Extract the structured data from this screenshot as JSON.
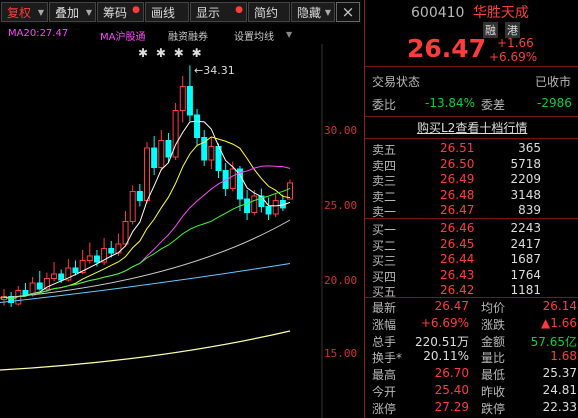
{
  "toolbar": {
    "buttons": [
      {
        "label": "复权",
        "active": true
      },
      {
        "label": "叠加",
        "active": false
      },
      {
        "label": "筹码",
        "active": false
      },
      {
        "label": "画线",
        "active": false
      },
      {
        "label": "显示",
        "active": false
      },
      {
        "label": "简约",
        "active": false
      },
      {
        "label": "隐藏",
        "active": false
      }
    ],
    "close_glyph": "×"
  },
  "legend": {
    "ma20": "MA20:27.47",
    "ma_extra": "MA沪股通",
    "margin": "融资融券",
    "setting": "设置均线"
  },
  "chart": {
    "stars": "✱ ✱ ✱      ✱",
    "high_marker": "34.31",
    "price_ticks": [
      "30.00",
      "25.00",
      "20.00",
      "15.00"
    ]
  },
  "quote": {
    "code": "600410",
    "name": "华胜天成",
    "badge_rong": "融",
    "badge_gang": "港",
    "price": "26.47",
    "change": "+1.66",
    "change_pct": "+6.69%"
  },
  "status": {
    "label": "交易状态",
    "value": "已收市",
    "weibi_label": "委比",
    "weibi_value": "-13.84%",
    "weicha_label": "委差",
    "weicha_value": "-2986"
  },
  "l2_link": "购买L2查看十档行情",
  "sell_orders": [
    {
      "label": "卖五",
      "price": "26.51",
      "vol": "365"
    },
    {
      "label": "卖四",
      "price": "26.50",
      "vol": "5718"
    },
    {
      "label": "卖三",
      "price": "26.49",
      "vol": "2209"
    },
    {
      "label": "卖二",
      "price": "26.48",
      "vol": "3148"
    },
    {
      "label": "卖一",
      "price": "26.47",
      "vol": "839"
    }
  ],
  "buy_orders": [
    {
      "label": "买一",
      "price": "26.46",
      "vol": "2243"
    },
    {
      "label": "买二",
      "price": "26.45",
      "vol": "2417"
    },
    {
      "label": "买三",
      "price": "26.44",
      "vol": "1687"
    },
    {
      "label": "买四",
      "price": "26.43",
      "vol": "1764"
    },
    {
      "label": "买五",
      "price": "26.42",
      "vol": "1181"
    }
  ],
  "stats": [
    {
      "l1": "最新",
      "v1": "26.47",
      "l2": "均价",
      "v2": "26.14"
    },
    {
      "l1": "涨幅",
      "v1": "+6.69%",
      "l2": "涨跌",
      "v2": "▲1.66"
    },
    {
      "l1": "总手",
      "v1": "220.51万",
      "l2": "金额",
      "v2": "57.65亿"
    },
    {
      "l1": "换手*",
      "v1": "20.11%",
      "l2": "量比",
      "v2": "1.68"
    },
    {
      "l1": "最高",
      "v1": "26.70",
      "l2": "最低",
      "v2": "25.37"
    },
    {
      "l1": "今开",
      "v1": "25.40",
      "l2": "昨收",
      "v2": "24.81"
    },
    {
      "l1": "涨停",
      "v1": "27.29",
      "l2": "跌停",
      "v2": "22.33"
    }
  ],
  "colors": {
    "up": "#ff3b3b",
    "down": "#00ffff",
    "ma5": "#ffffff",
    "ma10": "#ffff33",
    "ma20": "#ff44ff",
    "ma30": "#33ff33",
    "ma60": "#66ccff",
    "ma120": "#ffffaa"
  }
}
